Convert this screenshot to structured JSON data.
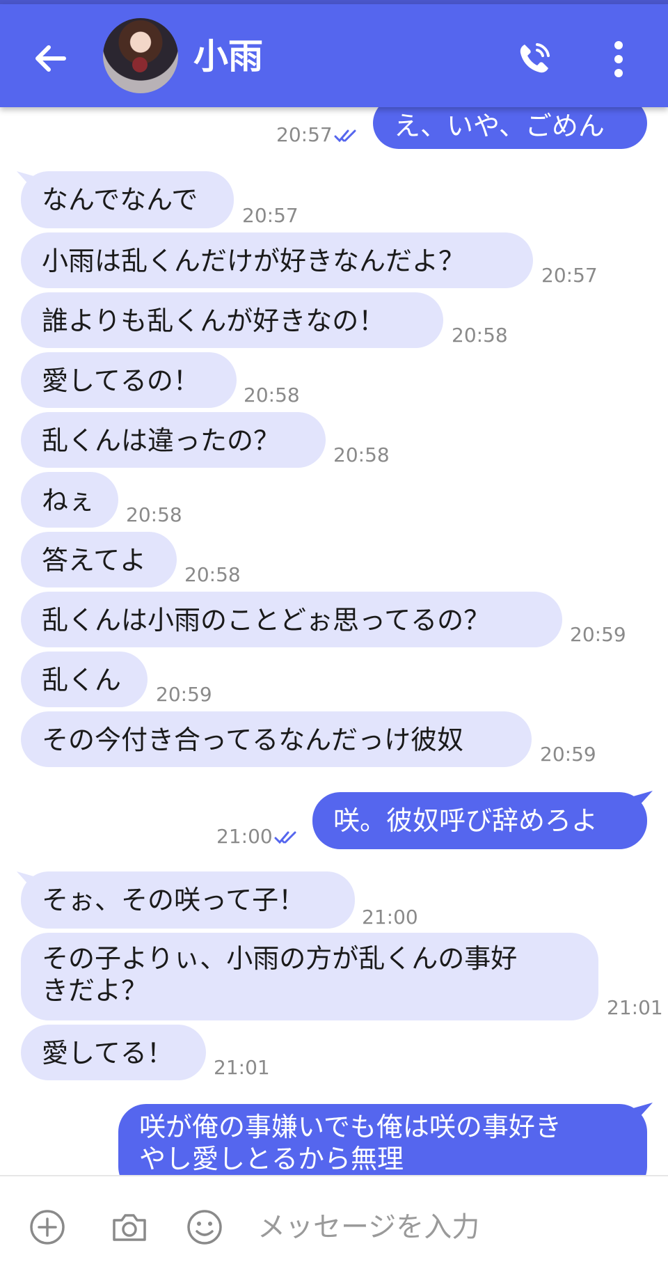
{
  "header": {
    "title": "小雨",
    "colors": {
      "accent": "#5566ee",
      "incoming_bubble": "#e2e4fc"
    }
  },
  "messages": [
    {
      "dir": "out",
      "text": "え、いや、ごめん",
      "time": "20:57"
    },
    {
      "dir": "in",
      "text": "なんでなんで",
      "time": "20:57"
    },
    {
      "dir": "in",
      "text": "小雨は乱くんだけが好きなんだよ？",
      "time": "20:57"
    },
    {
      "dir": "in",
      "text": "誰よりも乱くんが好きなの！",
      "time": "20:58"
    },
    {
      "dir": "in",
      "text": "愛してるの！",
      "time": "20:58"
    },
    {
      "dir": "in",
      "text": "乱くんは違ったの？",
      "time": "20:58"
    },
    {
      "dir": "in",
      "text": "ねぇ",
      "time": "20:58"
    },
    {
      "dir": "in",
      "text": "答えてよ",
      "time": "20:58"
    },
    {
      "dir": "in",
      "text": "乱くんは小雨のことどぉ思ってるの？",
      "time": "20:59"
    },
    {
      "dir": "in",
      "text": "乱くん",
      "time": "20:59"
    },
    {
      "dir": "in",
      "text": "その今付き合ってるなんだっけ彼奴",
      "time": "20:59"
    },
    {
      "dir": "out",
      "text": "咲。彼奴呼び辞めろよ",
      "time": "21:00"
    },
    {
      "dir": "in",
      "text": "そぉ、その咲って子！",
      "time": "21:00"
    },
    {
      "dir": "in",
      "text_line1": "その子よりぃ、小雨の方が乱くんの事好",
      "text_line2": "きだよ？",
      "time": "21:01"
    },
    {
      "dir": "in",
      "text": "愛してる！",
      "time": "21:01"
    },
    {
      "dir": "out",
      "text_line1": "咲が俺の事嫌いでも俺は咲の事好き",
      "text_line2": "やし愛しとるから無理"
    }
  ],
  "input": {
    "placeholder": "メッセージを入力",
    "icons": [
      "plus-icon",
      "camera-icon",
      "emoji-icon"
    ]
  },
  "icons": {
    "back": "arrow-left-icon",
    "call": "phone-icon",
    "menu": "more-vertical-icon",
    "read": "double-check-icon"
  }
}
